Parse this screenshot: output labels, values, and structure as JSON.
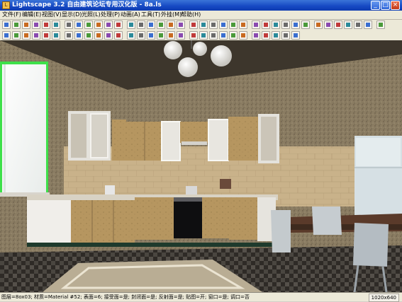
{
  "window": {
    "title": "Lightscape 3.2 自由建筑论坛专用汉化版   - 8a.ls",
    "app_icon": "lightscape-icon",
    "controls": [
      "minimize",
      "maximize",
      "close"
    ]
  },
  "menu": [
    {
      "label": "文件(F)"
    },
    {
      "label": "编辑(E)"
    },
    {
      "label": "视图(V)"
    },
    {
      "label": "显示(D)"
    },
    {
      "label": "光照(L)"
    },
    {
      "label": "处理(P)"
    },
    {
      "label": "动画(A)"
    },
    {
      "label": "工具(T)"
    },
    {
      "label": "外挂(M)"
    },
    {
      "label": "帮助(H)"
    }
  ],
  "toolbar1_icons": [
    "new-icon",
    "open-icon",
    "save-icon",
    "undo-icon",
    "print-icon",
    "help-icon",
    "help-cursor-icon",
    "move-icon",
    "rotate-icon",
    "axis-x-icon",
    "axis-y-icon",
    "axis-z-icon",
    "curve-icon",
    "scale-icon",
    "layer-icon",
    "copy-icon",
    "paste-icon",
    "render-icon",
    "cube-icon",
    "sphere-icon",
    "magnify-icon",
    "walk-icon",
    "orbit-icon",
    "zoom-icon",
    "hand-icon",
    "pan-icon",
    "dolly-icon",
    "zoom-extents-icon",
    "zoom-window-icon",
    "camera-icon",
    "fly-icon",
    "light-icon",
    "view-icon",
    "display-icon",
    "sun-icon",
    "screen-icon",
    "lamp-icon"
  ],
  "toolbar2_icons": [
    "cube-solid-icon",
    "cube-wire-icon",
    "select-icon",
    "select-add-icon",
    "select-remove-icon",
    "select-box-icon",
    "invert-icon",
    "grid-icon",
    "texture-icon",
    "material-icon",
    "light-source-icon",
    "luminaire-icon",
    "solution-icon",
    "wrench-icon",
    "pencil-icon",
    "eraser-icon",
    "color-icon",
    "brightness-icon",
    "globe-icon",
    "mesh-icon",
    "bitmap-icon",
    "target-icon",
    "block-1-icon",
    "block-2-icon",
    "block-3-icon",
    "block-4-icon",
    "block-5-icon",
    "block-6-icon",
    "block-7-icon"
  ],
  "colors": {
    "titlebar": "#1548c2",
    "chrome": "#ece9d8",
    "window_frame_highlight": "#3ee04a",
    "wall_paper": "#8a7c62",
    "tile_wall": "#c9b28a",
    "cabinet_wood": "#b69660"
  },
  "status": {
    "text": "图层=8ox03; 材质=Material #52; 表面=6; 接受面=是; 封闭面=是; 反射面=是; 贴图=开; 窗口=是; 调口=否",
    "resolution": "1020x640"
  }
}
